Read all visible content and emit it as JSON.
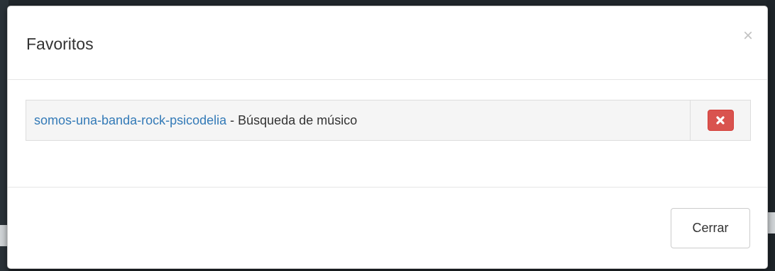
{
  "modal": {
    "title": "Favoritos",
    "close_symbol": "×"
  },
  "favorites": [
    {
      "link_text": "somos-una-banda-rock-psicodelia",
      "separator": " - ",
      "description": "Búsqueda de músico",
      "delete_icon": "remove-icon"
    }
  ],
  "footer": {
    "close_label": "Cerrar"
  },
  "colors": {
    "link": "#337ab7",
    "danger": "#d9534f",
    "row_background": "#f5f5f5"
  }
}
